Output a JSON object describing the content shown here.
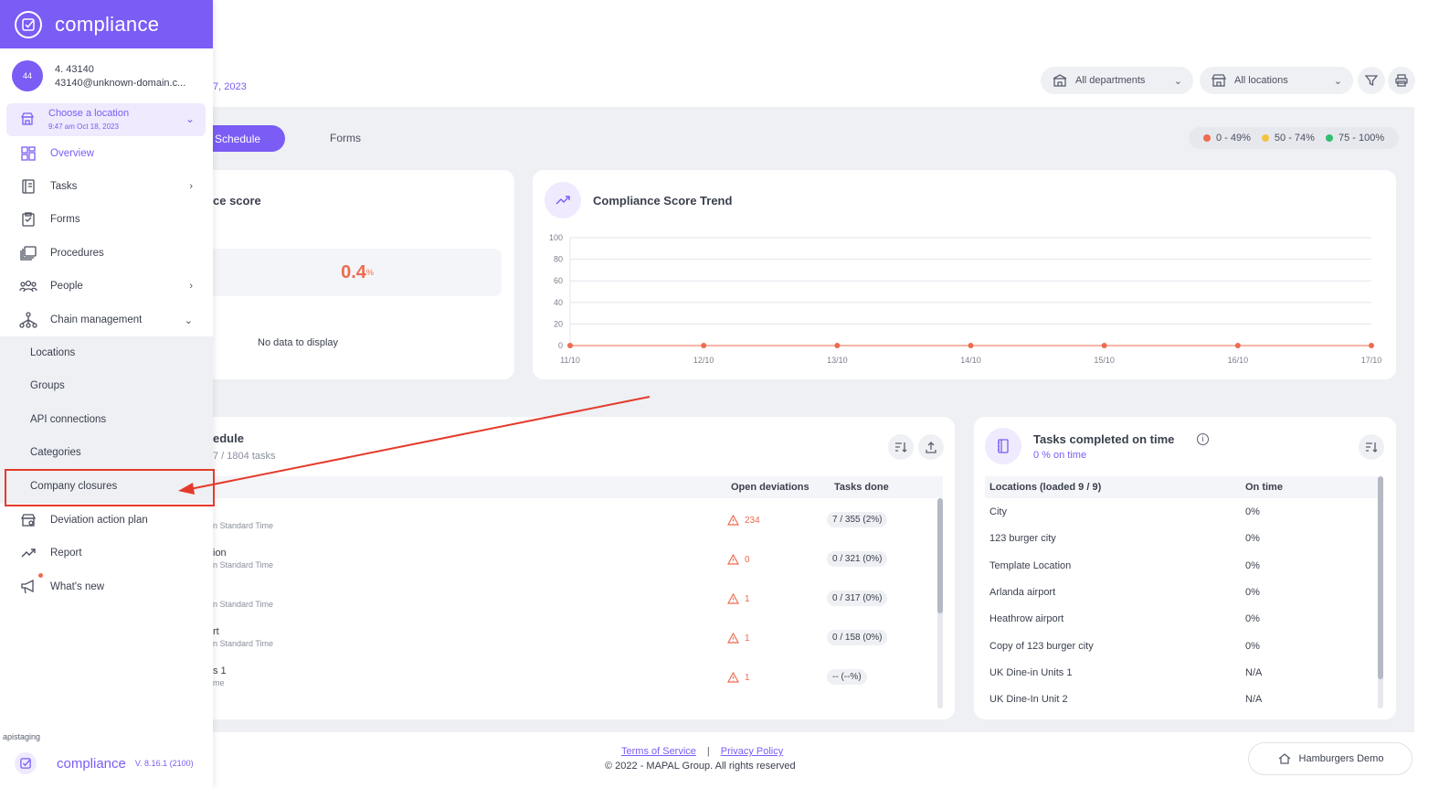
{
  "header": {
    "date_fragment": "7, 2023",
    "departments": "All departments",
    "locations": "All locations"
  },
  "tabs": [
    {
      "label": "Schedule",
      "active": true
    },
    {
      "label": "Forms",
      "active": false
    }
  ],
  "legend": [
    {
      "label": "0 - 49%",
      "color": "#ef6b4f"
    },
    {
      "label": "50 - 74%",
      "color": "#f5c342"
    },
    {
      "label": "75 - 100%",
      "color": "#2fbf71"
    }
  ],
  "score_card": {
    "title_fragment": "ce score",
    "value": "0.4",
    "unit": "%",
    "empty_text": "No data to display"
  },
  "trend_card": {
    "title": "Compliance Score Trend"
  },
  "chart_data": {
    "type": "line",
    "title": "Compliance Score Trend",
    "x": [
      "11/10",
      "12/10",
      "13/10",
      "14/10",
      "15/10",
      "16/10",
      "17/10"
    ],
    "series": [
      {
        "values": [
          0,
          0,
          0,
          0,
          0,
          0,
          0
        ],
        "color": "#ef6b4f"
      }
    ],
    "y_ticks": [
      0,
      20,
      40,
      60,
      80,
      100
    ],
    "ylim": [
      0,
      100
    ],
    "grid": true
  },
  "schedule_card": {
    "title_fragment": "edule",
    "subtitle_fragment": "7 / 1804 tasks",
    "col_deviations": "Open deviations",
    "col_done": "Tasks done",
    "rows": [
      {
        "name": "",
        "sub": "n Standard Time",
        "deviations": "234",
        "done": "7 / 355 (2%)"
      },
      {
        "name": "ion",
        "sub": "n Standard Time",
        "deviations": "0",
        "done": "0 / 321 (0%)"
      },
      {
        "name": "",
        "sub": "n Standard Time",
        "deviations": "1",
        "done": "0 / 317 (0%)"
      },
      {
        "name": "rt",
        "sub": "n Standard Time",
        "deviations": "1",
        "done": "0 / 158 (0%)"
      },
      {
        "name": "s 1",
        "sub": "me",
        "deviations": "1",
        "done": "-- (--%)"
      }
    ]
  },
  "ontime_card": {
    "title": "Tasks completed on time",
    "subtitle": "0 % on time",
    "col_location": "Locations (loaded 9 / 9)",
    "col_ontime": "On time",
    "rows": [
      {
        "location": "City",
        "value": "0%"
      },
      {
        "location": "123 burger city",
        "value": "0%"
      },
      {
        "location": "Template Location",
        "value": "0%"
      },
      {
        "location": "Arlanda airport",
        "value": "0%"
      },
      {
        "location": "Heathrow airport",
        "value": "0%"
      },
      {
        "location": "Copy of 123 burger city",
        "value": "0%"
      },
      {
        "location": "UK Dine-in Units 1",
        "value": "N/A"
      },
      {
        "location": "UK Dine-In Unit 2",
        "value": "N/A"
      }
    ]
  },
  "footer": {
    "terms": "Terms of Service",
    "separator": "|",
    "privacy": "Privacy Policy",
    "copyright": "© 2022 - MAPAL Group. All rights reserved",
    "demo": "Hamburgers Demo"
  },
  "sidebar": {
    "brand": "compliance",
    "avatar": "44",
    "user_name": "4. 43140",
    "user_email": "43140@unknown-domain.c...",
    "location_label": "Choose a location",
    "location_time": "9:47 am Oct 18, 2023",
    "items": [
      {
        "label": "Overview",
        "icon": "overview-icon"
      },
      {
        "label": "Tasks",
        "icon": "tasks-icon"
      },
      {
        "label": "Forms",
        "icon": "forms-icon"
      },
      {
        "label": "Procedures",
        "icon": "procedures-icon"
      },
      {
        "label": "People",
        "icon": "people-icon"
      },
      {
        "label": "Chain management",
        "icon": "chain-icon"
      }
    ],
    "sub_items": [
      "Locations",
      "Groups",
      "API connections",
      "Categories",
      "Company closures"
    ],
    "items_after": [
      {
        "label": "Deviation action plan",
        "icon": "deviation-icon"
      },
      {
        "label": "Report",
        "icon": "report-icon"
      },
      {
        "label": "What's new",
        "icon": "megaphone-icon"
      }
    ],
    "env": "apistaging",
    "bottom_brand": "compliance",
    "version": "V. 8.16.1 (2100)"
  },
  "colors": {
    "accent": "#7b5cf5",
    "danger": "#ef6b4f",
    "annotation": "#e53a2b"
  }
}
